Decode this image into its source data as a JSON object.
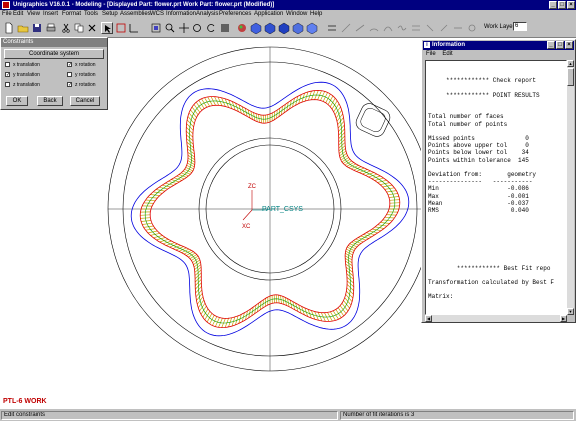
{
  "window": {
    "title": "Unigraphics V16.0.1 - Modeling - [Displayed Part: flower.prt   Work Part: flower.prt (Modified)]",
    "minimize": "_",
    "maximize": "□",
    "close": "×"
  },
  "menu": [
    "File",
    "Edit",
    "View",
    "Insert",
    "Format",
    "Tools",
    "Setup",
    "Assemblies",
    "WCS",
    "Information",
    "Analysis",
    "Preferences",
    "Application",
    "Window",
    "Help"
  ],
  "work_layer": {
    "label": "Work Layer",
    "value": "6"
  },
  "constraints": {
    "title": "Constraints",
    "coord_button": "Coordinate system",
    "options": [
      {
        "label": "x translation",
        "checked": false
      },
      {
        "label": "x rotation",
        "checked": true
      },
      {
        "label": "y translation",
        "checked": true
      },
      {
        "label": "y rotation",
        "checked": false
      },
      {
        "label": "z translation",
        "checked": false
      },
      {
        "label": "z rotation",
        "checked": true
      }
    ],
    "ok": "OK",
    "back": "Back",
    "cancel": "Cancel"
  },
  "info": {
    "title": "Information",
    "menu": [
      "File",
      "Edit"
    ],
    "lines": [
      "",
      "",
      "     ************ Check report",
      "",
      "     ************ POINT RESULTS",
      "",
      "",
      "Total number of faces",
      "Total number of points",
      "",
      "Missed points              0",
      "Points above upper tol     0",
      "Points below lower tol    34",
      "Points within tolerance  145",
      "",
      "Deviation from:       geometry",
      "---------------   -----------",
      "Min                   -0.086",
      "Max                   -0.001",
      "Mean                  -0.037",
      "RMS                    0.040",
      "",
      "",
      "",
      "",
      "",
      "",
      "",
      "        ************ Best Fit repo",
      "",
      "Transformation calculated by Best F",
      "",
      "Matrix:"
    ]
  },
  "csys": {
    "zc": "ZC",
    "xc": "XC",
    "label": "PART_CSYS"
  },
  "wcs_label": "PTL-6 WORK",
  "status": {
    "left": "Edit constraints",
    "right": "Number of fit iterations is 3"
  },
  "colors": {
    "title_bar": "#000080",
    "curve_red": "#e00000",
    "curve_blue": "#0000e0",
    "ticks": "#c8a000",
    "teal": "#008080"
  }
}
